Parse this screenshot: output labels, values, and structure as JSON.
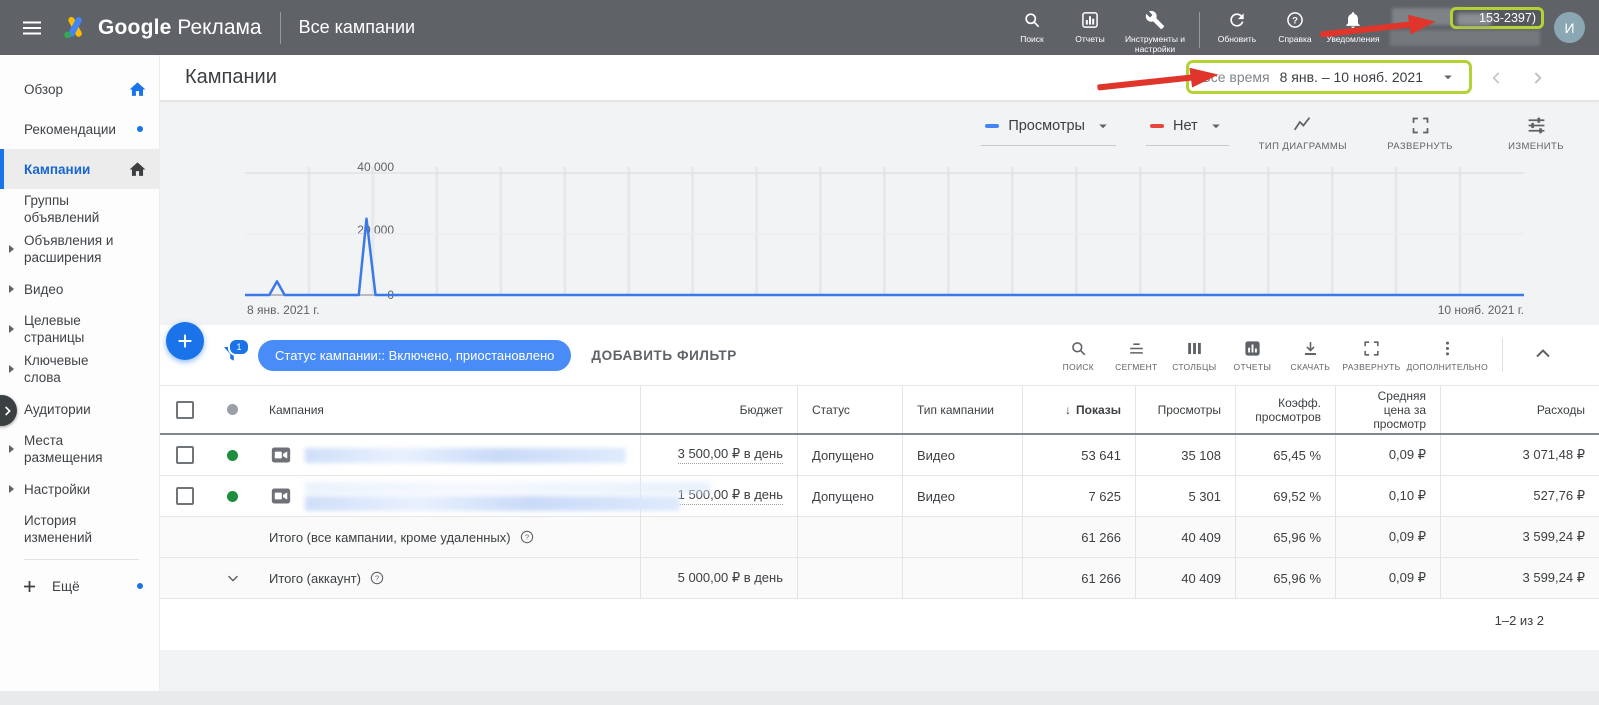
{
  "colors": {
    "topbar_gray": "#5f6368",
    "accent_blue": "#1a73e8",
    "chip_blue": "#4a8cf7",
    "line_blue": "#3b78e8",
    "metric2_red": "#e8453c",
    "green_dot": "#1e8e3e",
    "annotation_red": "#e0352b",
    "highlight_green": "#b3d234"
  },
  "topbar": {
    "brand_primary": "Google",
    "brand_secondary": "Реклама",
    "context_title": "Все кампании",
    "nav": [
      {
        "icon": "search",
        "label": "Поиск"
      },
      {
        "icon": "reports",
        "label": "Отчеты"
      },
      {
        "icon": "tools",
        "label": "Инструменты и настройки"
      },
      {
        "icon": "refresh",
        "label": "Обновить"
      },
      {
        "icon": "help",
        "label": "Справка"
      },
      {
        "icon": "bell",
        "label": "Уведомления"
      }
    ],
    "account_id_visible": "153-2397)",
    "avatar_letter": "И"
  },
  "sidebar": {
    "items": [
      {
        "label": "Обзор",
        "trailing": "home-blue"
      },
      {
        "label": "Рекомендации",
        "trailing": "dot"
      },
      {
        "label": "Кампании",
        "trailing": "home-dark",
        "selected": true
      },
      {
        "label": "Группы объявлений"
      },
      {
        "label": "Объявления и расширения",
        "expandable": true
      },
      {
        "label": "Видео",
        "expandable": true
      },
      {
        "label": "Целевые страницы",
        "expandable": true
      },
      {
        "label": "Ключевые слова",
        "expandable": true
      },
      {
        "label": "Аудитории"
      },
      {
        "label": "Места размещения",
        "expandable": true
      },
      {
        "label": "Настройки",
        "expandable": true
      },
      {
        "label": "История изменений"
      }
    ],
    "more_label": "Ещё"
  },
  "page_header": {
    "title": "Кампании",
    "date_preset": "Все время",
    "date_range": "8 янв. – 10 нояб. 2021"
  },
  "chart_controls": {
    "metric_primary": "Просмотры",
    "metric_secondary": "Нет",
    "buttons": [
      {
        "icon": "chart-type",
        "label": "ТИП ДИАГРАММЫ"
      },
      {
        "icon": "expand",
        "label": "РАЗВЕРНУТЬ"
      },
      {
        "icon": "tune",
        "label": "ИЗМЕНИТЬ"
      }
    ]
  },
  "chart_data": {
    "type": "line",
    "series": [
      {
        "name": "Просмотры",
        "color": "#3b78e8",
        "points": [
          [
            0,
            0
          ],
          [
            0.019,
            0
          ],
          [
            0.025,
            4500
          ],
          [
            0.031,
            0
          ],
          [
            0.089,
            0
          ],
          [
            0.095,
            25000
          ],
          [
            0.102,
            0
          ],
          [
            1,
            0
          ]
        ]
      }
    ],
    "secondary_metric": "Нет",
    "x_start_label": "8 янв. 2021 г.",
    "x_end_label": "10 нояб. 2021 г.",
    "yticks": [
      "0",
      "20 000",
      "40 000"
    ],
    "ylim": [
      0,
      43000
    ],
    "grid_vertical_divisions": 20,
    "grid": true,
    "legend_position": "top-right"
  },
  "filter_bar": {
    "filter_count": "1",
    "chip_label": "Статус кампании:: Включено, приостановлено",
    "add_filter_label": "ДОБАВИТЬ ФИЛЬТР",
    "tools": [
      {
        "icon": "search",
        "label": "ПОИСК"
      },
      {
        "icon": "segment",
        "label": "СЕГМЕНТ"
      },
      {
        "icon": "columns",
        "label": "СТОЛБЦЫ"
      },
      {
        "icon": "reports-filled",
        "label": "ОТЧЕТЫ"
      },
      {
        "icon": "download",
        "label": "СКАЧАТЬ"
      },
      {
        "icon": "expand",
        "label": "РАЗВЕРНУТЬ"
      },
      {
        "icon": "more",
        "label": "ДОПОЛНИТЕЛЬНО"
      }
    ]
  },
  "table": {
    "columns": [
      "Кампания",
      "Бюджет",
      "Статус",
      "Тип кампании",
      "Показы",
      "Просмотры",
      "Коэфф. просмотров",
      "Средняя цена за просмотр",
      "Расходы"
    ],
    "sorted_column": "Показы",
    "rows": [
      {
        "budget": "3 500,00 ₽ в день",
        "status": "Допущено",
        "campaign_type": "Видео",
        "impressions": "53 641",
        "views": "35 108",
        "view_rate": "65,45 %",
        "avg_cpv": "0,09 ₽",
        "cost": "3 071,48 ₽"
      },
      {
        "budget": "1 500,00 ₽ в день",
        "status": "Допущено",
        "campaign_type": "Видео",
        "impressions": "7 625",
        "views": "5 301",
        "view_rate": "69,52 %",
        "avg_cpv": "0,10 ₽",
        "cost": "527,76 ₽"
      }
    ],
    "totals": [
      {
        "label": "Итого (все кампании, кроме удаленных)",
        "budget": "",
        "impressions": "61 266",
        "views": "40 409",
        "view_rate": "65,96 %",
        "avg_cpv": "0,09 ₽",
        "cost": "3 599,24 ₽",
        "expandable": false
      },
      {
        "label": "Итого (аккаунт)",
        "budget": "5 000,00 ₽ в день",
        "impressions": "61 266",
        "views": "40 409",
        "view_rate": "65,96 %",
        "avg_cpv": "0,09 ₽",
        "cost": "3 599,24 ₽",
        "expandable": true
      }
    ],
    "pagination": "1–2 из 2"
  }
}
